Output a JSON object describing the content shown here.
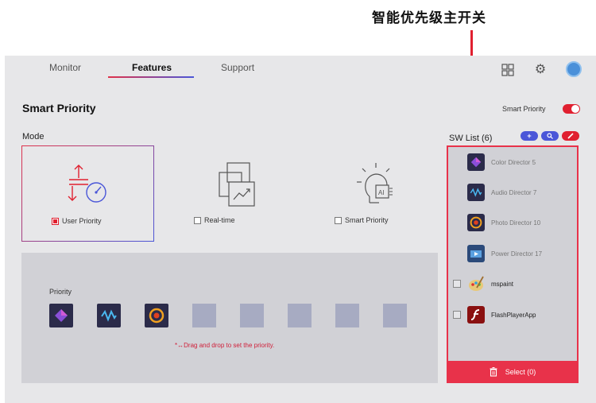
{
  "annotation": {
    "text": "智能优先级主开关"
  },
  "tabs": [
    {
      "label": "Monitor"
    },
    {
      "label": "Features"
    },
    {
      "label": "Support"
    }
  ],
  "header_icons": [
    "grid-icon",
    "gear-icon",
    "avatar"
  ],
  "page": {
    "title": "Smart Priority",
    "toggle_label": "Smart Priority",
    "toggle_on": true
  },
  "mode": {
    "label": "Mode",
    "options": [
      {
        "label": "User Priority",
        "checked": true
      },
      {
        "label": "Real-time",
        "checked": false
      },
      {
        "label": "Smart Priority",
        "checked": false
      }
    ]
  },
  "priority": {
    "label": "Priority",
    "filled_slots": [
      "color-director",
      "audio-director",
      "photo-director"
    ],
    "empty_slot_count": 5,
    "hint": "Drag and drop to set the priority."
  },
  "sw_list": {
    "label": "SW List (6)",
    "buttons": [
      "+",
      "🔍",
      "✎"
    ],
    "items": [
      {
        "name": "Color Director 5"
      },
      {
        "name": "Audio Director 7"
      },
      {
        "name": "Photo Director 10"
      },
      {
        "name": "Power Director 17"
      },
      {
        "name": "mspaint"
      },
      {
        "name": "FlashPlayerApp"
      }
    ],
    "select_label": "Select (0)"
  },
  "colors": {
    "accent": "#e02030",
    "blue": "#4a56d8",
    "panel": "#d1d1d6"
  }
}
